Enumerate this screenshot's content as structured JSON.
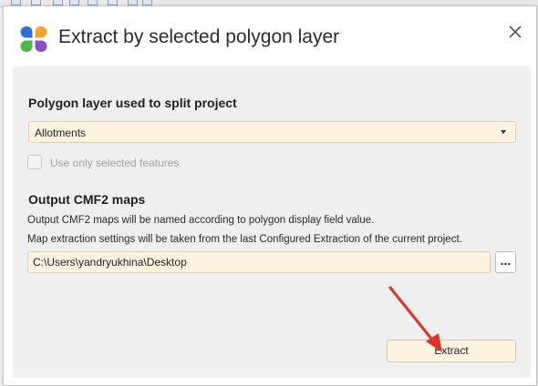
{
  "dialog": {
    "title": "Extract by selected polygon layer",
    "logo_icon": "app-logo-icon",
    "close_icon": "close-icon"
  },
  "polygon_section": {
    "heading": "Polygon layer used to split project",
    "layer_select": {
      "value": "Allotments",
      "icon": "chevron-down-icon"
    },
    "checkbox": {
      "label": "Use only selected features",
      "checked": false,
      "enabled": false
    }
  },
  "output_section": {
    "heading": "Output CMF2 maps",
    "line1": "Output CMF2 maps will be named according to polygon display field value.",
    "line2": "Map extraction settings will be taken from the last Configured Extraction of the current project.",
    "path_value": "C:\\Users\\yandryukhina\\Desktop",
    "browse_label": "..."
  },
  "actions": {
    "extract_label": "Extract"
  },
  "colors": {
    "accent_field": "#fdf4e0",
    "annotation_arrow": "#e0322b",
    "logo_blue": "#2f6fd6",
    "logo_orange": "#f0a42a",
    "logo_green": "#4cb84c",
    "logo_purple": "#8a4fc8"
  }
}
